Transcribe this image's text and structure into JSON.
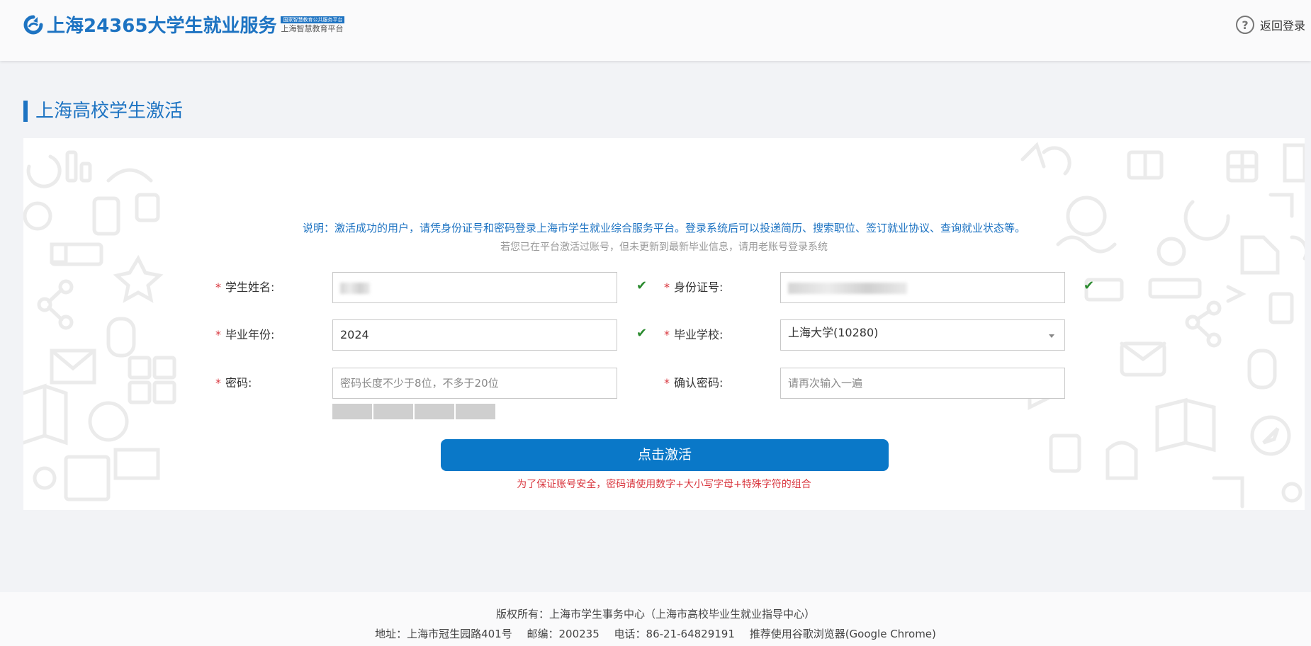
{
  "header": {
    "logo_text": "上海24365大学生就业服务",
    "logo_sub_top": "国家智慧教育公共服务平台",
    "logo_sub_bottom": "上海智慧教育平台",
    "back_login": "返回登录",
    "help_icon": "question-circle-icon"
  },
  "page_title": "上海高校学生激活",
  "notice": {
    "main": "说明：激活成功的用户，请凭身份证号和密码登录上海市学生就业综合服务平台。登录系统后可以投递简历、搜索职位、签订就业协议、查询就业状态等。",
    "sub": "若您已在平台激活过账号，但未更新到最新毕业信息，请用老账号登录系统"
  },
  "form": {
    "required_mark": "*",
    "name": {
      "label": "学生姓名:",
      "value": ""
    },
    "id_number": {
      "label": "身份证号:",
      "value": ""
    },
    "grad_year": {
      "label": "毕业年份:",
      "value": "2024"
    },
    "school": {
      "label": "毕业学校:",
      "value": "上海大学(10280)"
    },
    "password": {
      "label": "密码:",
      "placeholder": "密码长度不少于8位，不多于20位"
    },
    "confirm_password": {
      "label": "确认密码:",
      "placeholder": "请再次输入一遍"
    },
    "check_icon": "checkmark-icon",
    "strength_segments": 4
  },
  "activate_button": "点击激活",
  "password_warning": "为了保证账号安全，密码请使用数字+大小写字母+特殊字符的组合",
  "footer": {
    "copyright": "版权所有：上海市学生事务中心（上海市高校毕业生就业指导中心）",
    "address": "地址：上海市冠生园路401号",
    "postcode": "邮编：200235",
    "phone": "电话：86-21-64829191",
    "browser": "推荐使用谷歌浏览器(Google Chrome)"
  },
  "colors": {
    "brand": "#1d73c2",
    "button": "#0a78c8",
    "warning": "#d9363e",
    "check": "#2a8a2e"
  }
}
